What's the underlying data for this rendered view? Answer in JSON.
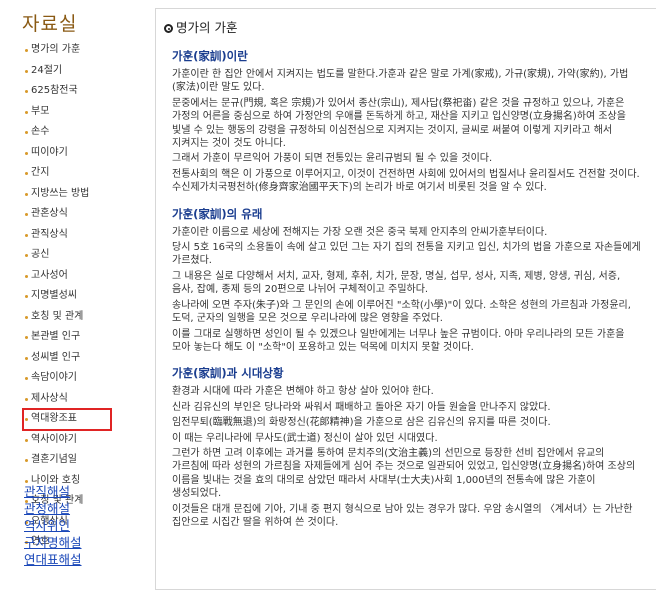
{
  "sidebar": {
    "title": "자료실",
    "items": [
      "명가의 가훈",
      "24절기",
      "625참전국",
      "부모",
      "손수",
      "띠이야기",
      "간지",
      "지방쓰는 방법",
      "관혼상식",
      "관직상식",
      "공신",
      "고사성어",
      "지명별성씨",
      "호칭 및 관계",
      "본관별 인구",
      "성씨별 인구",
      "속담이야기",
      "제사상식",
      "역대왕조표",
      "역사이야기",
      "결혼기념일",
      "나이와 호칭",
      "호칭 및 관계",
      "오행상식",
      "연호"
    ],
    "selected_index": 18,
    "links": [
      "관직해설",
      "관청해설",
      "역사위인",
      "구지명해설",
      "연대표해설"
    ]
  },
  "content": {
    "header": "명가의 가훈",
    "sections": [
      {
        "heading": "가훈(家訓)이란",
        "paragraphs": [
          "가훈이란 한 집안 안에서 지켜지는 법도를 말한다.가훈과 같은 말로 가계(家戒), 가규(家規), 가약(家約), 가법(家法)이란 말도 있다.",
          "문중에서는 문규(門規, 혹은 宗規)가 있어서 종산(宗山), 제사답(祭祀畓) 같은 것을 규정하고 있으나, 가훈은 가정의 어른을 중심으로 하여 가정안의 우애를 돈독하게 하고, 재산을 지키고 입신양명(立身揚名)하여 조상을 빛낼 수 있는 행동의 강령을 규정하되 이심전심으로 지켜지는 것이지, 글씨로 써붙여 이렇게 지키라고 해서 지켜지는 것이 것도 아니다.",
          "그래서 가훈이 무르익어 가풍이 되면 전통있는 윤리규범되 될 수 있을 것이다.",
          "전통사회의 핵은 이 가풍으로 이루어지고, 이것이 건전하면 사회에 있어서의 법질서나 윤리질서도 건전할 것이다. 수신제가치국평천하(修身齊家治國平天下)의 논리가 바로 여기서 비롯된 것을 알 수 있다."
        ]
      },
      {
        "heading": "가훈(家訓)의 유래",
        "paragraphs": [
          "가훈이란 이름으로 세상에 전해지는 가장 오랜 것은 중국 북제 안지추의 안씨가훈부터이다.",
          "당시 5호 16국의 소용돌이 속에 살고 있던 그는 자기 집의 전통을 지키고 입신, 치가의 법을 가훈으로 자손들에게 가르쳤다.",
          "그 내용은 실로 다양해서 서치, 교자, 형제, 후취, 치가, 문장, 명실, 섭무, 성사, 지족, 제병, 양생, 귀심, 서증, 음사, 잡예, 종제 등의 20편으로 나뉘어 구체적이고 주밀하다.",
          "송나라에 오면 주자(朱子)와 그 문인의 손에 이루어진 \"소학(小學)\"이 있다. 소학은 성현의 가르침과 가정윤리, 도덕, 군자의 일행을 모은 것으로 우리나라에 많은 영향을 주었다.",
          "이를 그대로 실행하면 성인이 될 수 있겠으나 일반에게는 너무나 높은 규범이다. 아마 우리나라의 모든 가훈을 모아 놓는다 해도 이 \"소학\"이 포용하고 있는 덕목에 미치지 못할 것이다."
        ]
      },
      {
        "heading": "가훈(家訓)과 시대상황",
        "paragraphs": [
          "환경과 시대에 따라 가훈은 변해야 하고 항상 살아 있어야 한다.",
          "신라 김유신의 부인은 당나라와 싸워서 패배하고 돌아온 자기 아들 원술을 만나주지 않았다.",
          "임전무퇴(臨戰無退)의 화랑정신(花郞精神)을 가훈으로 삼은 김유신의 유지를 따른 것이다.",
          "이 때는 우리나라에 무사도(武士道) 정신이 살아 있던 시대였다.",
          "그런가 하면 고려 이후에는 과거를 통하여 문치주의(文治主義)의 선민으로 등장한 선비 집안에서 유교의 가르침에 따라 성현의 가르침을 자제들에게 심어 주는 것으로 일관되어 있었고, 입신양명(立身揚名)하여 조상의 이름을 빛내는 것을 효의 대의로 삼았던 때라서 사대부(士大夫)사회 1,000년의 전통속에 많은 가훈이 생성되었다.",
          "이것들은 대개 문집에 기아, 기내 중 편지 형식으로 남아 있는 경우가 많다. 우암 송시열의 〈계서녀〉는 가난한 집안으로 시집간 딸을 위하여 쓴 것이다."
        ]
      }
    ]
  }
}
